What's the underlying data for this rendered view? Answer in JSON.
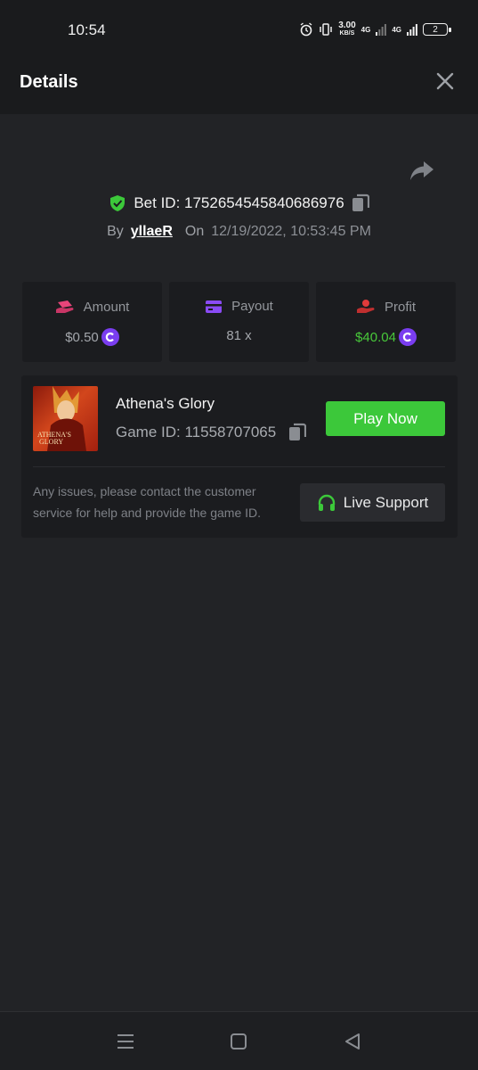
{
  "status_bar": {
    "time": "10:54",
    "speed_value": "3.00",
    "speed_unit": "KB/S",
    "network_1": "4G",
    "network_2": "4G",
    "battery": "2",
    "icons": [
      "alarm-icon",
      "vibrate-icon",
      "signal-icon",
      "battery-icon"
    ]
  },
  "header": {
    "title": "Details",
    "close_icon": "close-icon"
  },
  "bet": {
    "id_label": "Bet ID: 1752654545840686976",
    "by_label": "By",
    "username": "yllaeR",
    "on_label": "On",
    "datetime": "12/19/2022, 10:53:45 PM",
    "verified_color": "#3cc83a"
  },
  "stats": [
    {
      "label": "Amount",
      "value": "$0.50",
      "icon": "wallet-hand-icon",
      "icon_color": "#e8457a",
      "value_color": "#a4a7ac",
      "show_coin": true
    },
    {
      "label": "Payout",
      "value": "81 x",
      "icon": "card-icon",
      "icon_color": "#8a4bf5",
      "value_color": "#a4a7ac",
      "show_coin": false
    },
    {
      "label": "Profit",
      "value": "$40.04",
      "icon": "profit-hand-icon",
      "icon_color": "#e23b3b",
      "value_color": "#48c83a",
      "show_coin": true
    }
  ],
  "game": {
    "thumb_text_1": "ATHENA'S",
    "thumb_text_2": "GLORY",
    "name": "Athena's Glory",
    "id_label": "Game ID: 11558707065",
    "play_label": "Play Now",
    "notice": "Any issues, please contact the customer service for help and provide the game ID.",
    "support_label": "Live Support",
    "accent": "#3cc83a"
  },
  "nav": {
    "icons": [
      "menu-icon",
      "home-icon",
      "back-icon"
    ]
  }
}
